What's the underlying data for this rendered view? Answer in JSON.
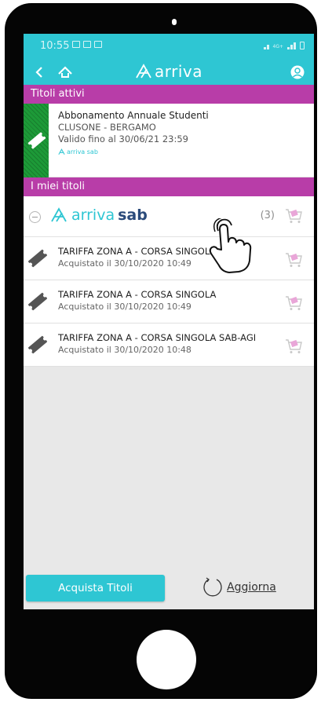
{
  "status_bar": {
    "time": "10:55",
    "net": "4G+"
  },
  "app_bar": {
    "logo_text": "arriva"
  },
  "sections": {
    "active_header": "Titoli attivi",
    "mine_header": "I miei titoli"
  },
  "active_ticket": {
    "title": "Abbonamento Annuale Studenti",
    "route": "CLUSONE - BERGAMO",
    "valid_until": "Valido fino al  30/06/21 23:59",
    "brand": "arriva sab"
  },
  "group": {
    "brand_arriva": "arriva",
    "brand_sab": "sab",
    "count": "(3)"
  },
  "tickets": [
    {
      "title": "TARIFFA ZONA A - CORSA SINGOLA",
      "purchased": "Acquistato il  30/10/2020 10:49"
    },
    {
      "title": "TARIFFA ZONA A - CORSA SINGOLA",
      "purchased": "Acquistato il  30/10/2020 10:49"
    },
    {
      "title": "TARIFFA ZONA A - CORSA SINGOLA SAB-AGI",
      "purchased": "Acquistato il  30/10/2020 10:48"
    }
  ],
  "footer": {
    "buy_label": "Acquista Titoli",
    "refresh_label": "Aggiorna"
  },
  "colors": {
    "accent": "#2ec6d3",
    "section": "#b83da8",
    "active_stripe": "#1d9a38",
    "cart": "#e9a6d8"
  },
  "icons": {
    "back": "chevron-left-icon",
    "home": "home-icon",
    "profile": "user-icon",
    "ticket": "ticket-icon",
    "cart": "cart-icon",
    "refresh": "refresh-icon",
    "hand": "hand-pointer-icon"
  }
}
